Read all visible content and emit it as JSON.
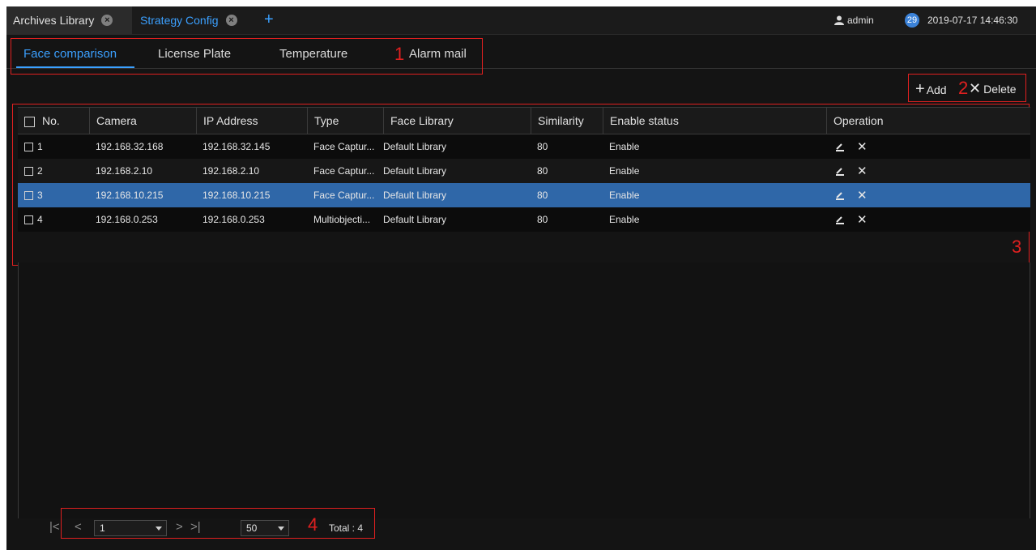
{
  "window_tabs": [
    {
      "label": "Archives Library"
    },
    {
      "label": "Strategy Config"
    }
  ],
  "header": {
    "user": "admin",
    "notification_count": "29",
    "datetime": "2019-07-17 14:46:30"
  },
  "sub_tabs": [
    {
      "label": "Face comparison",
      "active": true
    },
    {
      "label": "License Plate"
    },
    {
      "label": "Temperature"
    },
    {
      "label": "Alarm mail"
    }
  ],
  "toolbar": {
    "add_label": "Add",
    "delete_label": "Delete"
  },
  "annotations": [
    "1",
    "2",
    "3",
    "4"
  ],
  "table": {
    "headers": {
      "no": "No.",
      "camera": "Camera",
      "ip": "IP Address",
      "type": "Type",
      "face_library": "Face Library",
      "similarity": "Similarity",
      "enable_status": "Enable status",
      "operation": "Operation"
    },
    "rows": [
      {
        "no": "1",
        "camera": "192.168.32.168",
        "ip": "192.168.32.145",
        "type": "Face Captur...",
        "face_library": "Default Library",
        "similarity": "80",
        "enable_status": "Enable",
        "selected": false
      },
      {
        "no": "2",
        "camera": "192.168.2.10",
        "ip": "192.168.2.10",
        "type": "Face Captur...",
        "face_library": "Default Library",
        "similarity": "80",
        "enable_status": "Enable",
        "selected": false
      },
      {
        "no": "3",
        "camera": "192.168.10.215",
        "ip": "192.168.10.215",
        "type": "Face Captur...",
        "face_library": "Default Library",
        "similarity": "80",
        "enable_status": "Enable",
        "selected": true
      },
      {
        "no": "4",
        "camera": "192.168.0.253",
        "ip": "192.168.0.253",
        "type": "Multiobjecti...",
        "face_library": "Default Library",
        "similarity": "80",
        "enable_status": "Enable",
        "selected": false
      }
    ]
  },
  "pagination": {
    "page": "1",
    "page_size": "50",
    "total_label": "Total : 4"
  },
  "colors": {
    "accent": "#3ba0ff",
    "selected_row": "#2f67a8",
    "annotation": "#e02020"
  }
}
